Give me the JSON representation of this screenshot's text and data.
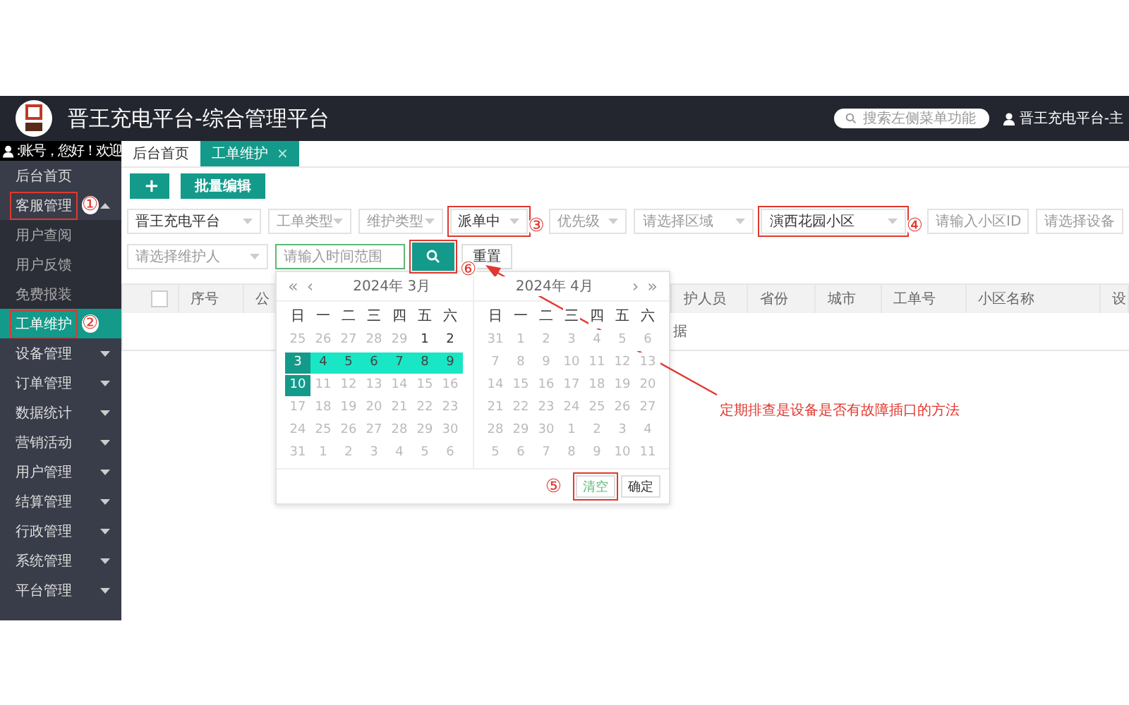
{
  "header": {
    "title": "晋王充电平台-综合管理平台",
    "search_placeholder": "搜索左侧菜单功能",
    "user": "晋王充电平台-主"
  },
  "sidebar": {
    "greeting": ":账号，您好！欢迎",
    "items": [
      {
        "label": "后台首页",
        "selected": false
      },
      {
        "label": "客服管理",
        "selected": false,
        "expanded": true,
        "marker": "①",
        "children": [
          {
            "label": "用户查阅",
            "selected": false
          },
          {
            "label": "用户反馈",
            "selected": false
          },
          {
            "label": "免费报装",
            "selected": false
          },
          {
            "label": "工单维护",
            "selected": true,
            "marker": "②"
          }
        ]
      },
      {
        "label": "设备管理",
        "selected": false,
        "expanded": false
      },
      {
        "label": "订单管理",
        "selected": false,
        "expanded": false
      },
      {
        "label": "数据统计",
        "selected": false,
        "expanded": false
      },
      {
        "label": "营销活动",
        "selected": false,
        "expanded": false
      },
      {
        "label": "用户管理",
        "selected": false,
        "expanded": false
      },
      {
        "label": "结算管理",
        "selected": false,
        "expanded": false
      },
      {
        "label": "行政管理",
        "selected": false,
        "expanded": false
      },
      {
        "label": "系统管理",
        "selected": false,
        "expanded": false
      },
      {
        "label": "平台管理",
        "selected": false,
        "expanded": false
      }
    ]
  },
  "tabs": [
    {
      "label": "后台首页",
      "selected": false
    },
    {
      "label": "工单维护",
      "selected": true,
      "close": "×"
    }
  ],
  "toolbar": [
    {
      "kind": "add",
      "label": "+"
    },
    {
      "kind": "text",
      "label": "批量编辑"
    }
  ],
  "filters": [
    [
      {
        "kind": "select",
        "value": "晋王充电平台"
      },
      {
        "kind": "select",
        "placeholder": "工单类型"
      },
      {
        "kind": "select",
        "placeholder": "维护类型"
      },
      {
        "kind": "select",
        "value": "派单中",
        "marker": "③"
      },
      {
        "kind": "select",
        "placeholder": "优先级"
      },
      {
        "kind": "select",
        "placeholder": "请选择区域"
      },
      {
        "kind": "select",
        "value": "演西花园小区",
        "marker": "④"
      },
      {
        "kind": "input",
        "placeholder": "请输入小区ID"
      },
      {
        "kind": "select",
        "placeholder": "请选择设备"
      }
    ],
    [
      {
        "kind": "select",
        "placeholder": "请选择维护人"
      },
      {
        "kind": "date",
        "placeholder": "请输入时间范围",
        "focused": true
      },
      {
        "kind": "search",
        "marker": "⑥"
      },
      {
        "kind": "button",
        "label": "重置"
      }
    ]
  ],
  "table": {
    "select_all": {
      "checked": false
    },
    "columns": [
      "",
      "序号",
      "公",
      "护人员",
      "省份",
      "城市",
      "工单号",
      "小区名称",
      "设"
    ],
    "empty_text": "据"
  },
  "calendar": {
    "months": [
      {
        "title": "2024年  3月",
        "nav": [
          "«",
          "‹"
        ],
        "weekdays": [
          "日",
          "一",
          "二",
          "三",
          "四",
          "五",
          "六"
        ],
        "weeks": [
          [
            {
              "d": "25",
              "kind": "muted"
            },
            {
              "d": "26",
              "kind": "muted"
            },
            {
              "d": "27",
              "kind": "muted"
            },
            {
              "d": "28",
              "kind": "muted"
            },
            {
              "d": "29",
              "kind": "muted"
            },
            {
              "d": "1",
              "kind": "normal"
            },
            {
              "d": "2",
              "kind": "normal"
            }
          ],
          [
            {
              "d": "3",
              "kind": "end"
            },
            {
              "d": "4",
              "kind": "range"
            },
            {
              "d": "5",
              "kind": "range"
            },
            {
              "d": "6",
              "kind": "range"
            },
            {
              "d": "7",
              "kind": "range"
            },
            {
              "d": "8",
              "kind": "range"
            },
            {
              "d": "9",
              "kind": "range"
            }
          ],
          [
            {
              "d": "10",
              "kind": "end"
            },
            {
              "d": "11",
              "kind": "muted"
            },
            {
              "d": "12",
              "kind": "muted"
            },
            {
              "d": "13",
              "kind": "muted"
            },
            {
              "d": "14",
              "kind": "muted"
            },
            {
              "d": "15",
              "kind": "muted"
            },
            {
              "d": "16",
              "kind": "muted"
            }
          ],
          [
            {
              "d": "17",
              "kind": "muted"
            },
            {
              "d": "18",
              "kind": "muted"
            },
            {
              "d": "19",
              "kind": "muted"
            },
            {
              "d": "20",
              "kind": "muted"
            },
            {
              "d": "21",
              "kind": "muted"
            },
            {
              "d": "22",
              "kind": "muted"
            },
            {
              "d": "23",
              "kind": "muted"
            }
          ],
          [
            {
              "d": "24",
              "kind": "muted"
            },
            {
              "d": "25",
              "kind": "muted"
            },
            {
              "d": "26",
              "kind": "muted"
            },
            {
              "d": "27",
              "kind": "muted"
            },
            {
              "d": "28",
              "kind": "muted"
            },
            {
              "d": "29",
              "kind": "muted"
            },
            {
              "d": "30",
              "kind": "muted"
            }
          ],
          [
            {
              "d": "31",
              "kind": "muted"
            },
            {
              "d": "1",
              "kind": "muted"
            },
            {
              "d": "2",
              "kind": "muted"
            },
            {
              "d": "3",
              "kind": "muted"
            },
            {
              "d": "4",
              "kind": "muted"
            },
            {
              "d": "5",
              "kind": "muted"
            },
            {
              "d": "6",
              "kind": "muted"
            }
          ]
        ]
      },
      {
        "title": "2024年  4月",
        "nav": [
          "›",
          "»"
        ],
        "weekdays": [
          "日",
          "一",
          "二",
          "三",
          "四",
          "五",
          "六"
        ],
        "weeks": [
          [
            {
              "d": "31",
              "kind": "muted"
            },
            {
              "d": "1",
              "kind": "muted"
            },
            {
              "d": "2",
              "kind": "muted"
            },
            {
              "d": "3",
              "kind": "muted"
            },
            {
              "d": "4",
              "kind": "muted"
            },
            {
              "d": "5",
              "kind": "muted"
            },
            {
              "d": "6",
              "kind": "muted"
            }
          ],
          [
            {
              "d": "7",
              "kind": "muted"
            },
            {
              "d": "8",
              "kind": "muted"
            },
            {
              "d": "9",
              "kind": "muted"
            },
            {
              "d": "10",
              "kind": "muted"
            },
            {
              "d": "11",
              "kind": "muted"
            },
            {
              "d": "12",
              "kind": "muted"
            },
            {
              "d": "13",
              "kind": "muted"
            }
          ],
          [
            {
              "d": "14",
              "kind": "muted"
            },
            {
              "d": "15",
              "kind": "muted"
            },
            {
              "d": "16",
              "kind": "muted"
            },
            {
              "d": "17",
              "kind": "muted"
            },
            {
              "d": "18",
              "kind": "muted"
            },
            {
              "d": "19",
              "kind": "muted"
            },
            {
              "d": "20",
              "kind": "muted"
            }
          ],
          [
            {
              "d": "21",
              "kind": "muted"
            },
            {
              "d": "22",
              "kind": "muted"
            },
            {
              "d": "23",
              "kind": "muted"
            },
            {
              "d": "24",
              "kind": "muted"
            },
            {
              "d": "25",
              "kind": "muted"
            },
            {
              "d": "26",
              "kind": "muted"
            },
            {
              "d": "27",
              "kind": "muted"
            }
          ],
          [
            {
              "d": "28",
              "kind": "muted"
            },
            {
              "d": "29",
              "kind": "muted"
            },
            {
              "d": "30",
              "kind": "muted"
            },
            {
              "d": "1",
              "kind": "muted"
            },
            {
              "d": "2",
              "kind": "muted"
            },
            {
              "d": "3",
              "kind": "muted"
            },
            {
              "d": "4",
              "kind": "muted"
            }
          ],
          [
            {
              "d": "5",
              "kind": "muted"
            },
            {
              "d": "6",
              "kind": "muted"
            },
            {
              "d": "7",
              "kind": "muted"
            },
            {
              "d": "8",
              "kind": "muted"
            },
            {
              "d": "9",
              "kind": "muted"
            },
            {
              "d": "10",
              "kind": "muted"
            },
            {
              "d": "11",
              "kind": "muted"
            }
          ]
        ]
      }
    ],
    "buttons": [
      {
        "label": "清空",
        "marker": "⑤"
      },
      {
        "label": "确定"
      }
    ]
  },
  "annotation": {
    "note": "定期排查是设备是否有故障插口的方法"
  }
}
